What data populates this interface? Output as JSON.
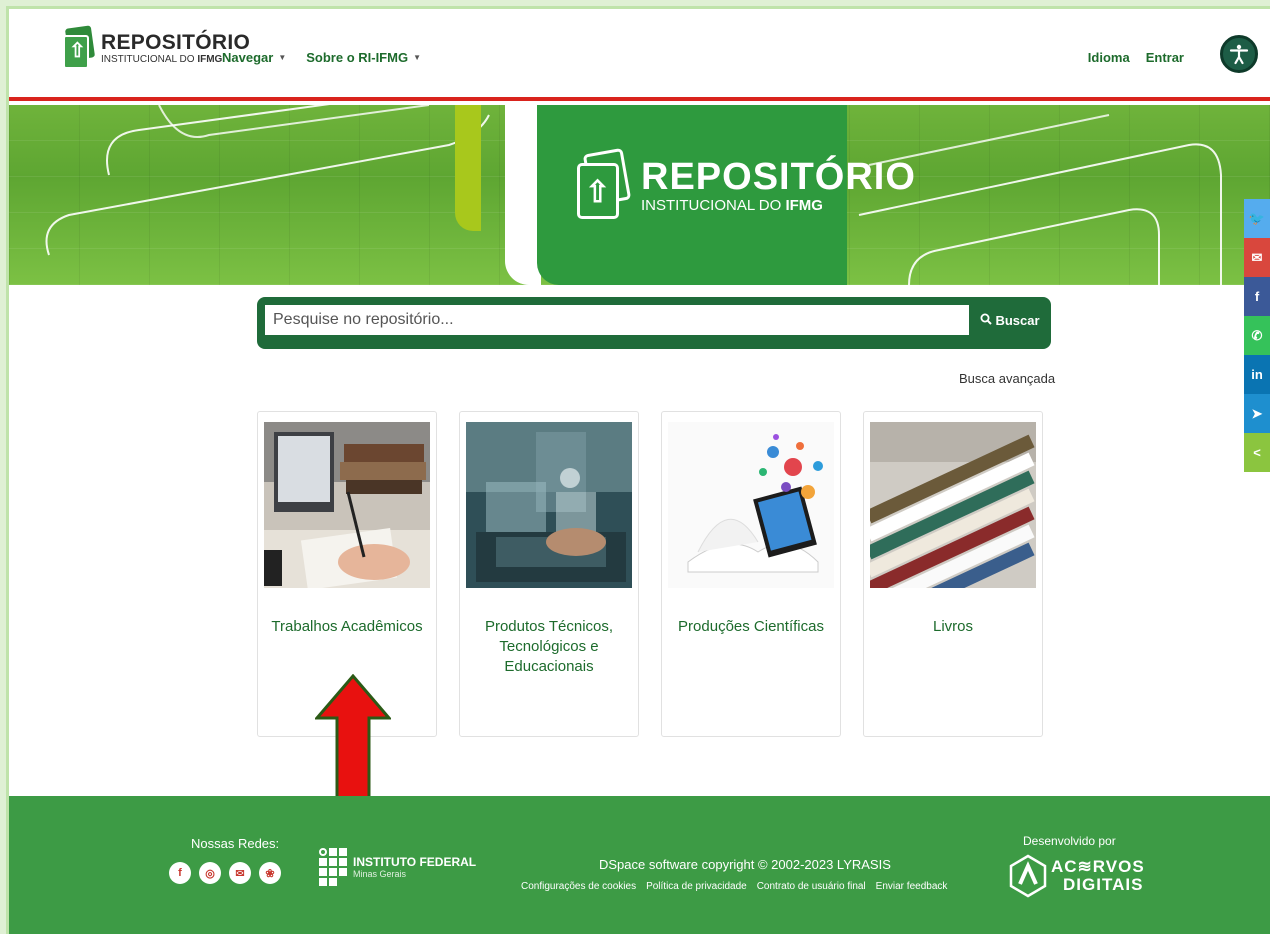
{
  "header": {
    "logo_title": "REPOSITÓRIO",
    "logo_subtitle_prefix": "INSTITUCIONAL DO ",
    "logo_subtitle_bold": "IFMG",
    "nav": [
      {
        "label": "Navegar"
      },
      {
        "label": "Sobre o RI-IFMG"
      }
    ],
    "language_label": "Idioma",
    "login_label": "Entrar",
    "accessibility_icon": "accessibility-icon"
  },
  "banner": {
    "title": "REPOSITÓRIO",
    "subtitle_prefix": "INSTITUCIONAL DO ",
    "subtitle_bold": "IFMG"
  },
  "share_bar": {
    "items": [
      {
        "icon": "twitter-icon",
        "glyph": "🐦",
        "color": "#55acee"
      },
      {
        "icon": "email-icon",
        "glyph": "✉",
        "color": "#d9473d"
      },
      {
        "icon": "facebook-icon",
        "glyph": "f",
        "color": "#3b5998"
      },
      {
        "icon": "whatsapp-icon",
        "glyph": "✆",
        "color": "#35c25a"
      },
      {
        "icon": "linkedin-icon",
        "glyph": "in",
        "color": "#0a74b2"
      },
      {
        "icon": "telegram-icon",
        "glyph": "➤",
        "color": "#1e8fcf"
      },
      {
        "icon": "share-icon",
        "glyph": "<",
        "color": "#8bc53f"
      }
    ]
  },
  "search": {
    "placeholder": "Pesquise no repositório...",
    "button_label": "Buscar",
    "advanced_label": "Busca avançada"
  },
  "cards": [
    {
      "label": "Trabalhos Acadêmicos"
    },
    {
      "label": "Produtos Técnicos, Tecnológicos e Educacionais"
    },
    {
      "label": "Produções Científicas"
    },
    {
      "label": "Livros"
    }
  ],
  "footer": {
    "social_title": "Nossas Redes:",
    "social": [
      {
        "icon": "facebook-icon",
        "glyph": "f"
      },
      {
        "icon": "instagram-icon",
        "glyph": "◎"
      },
      {
        "icon": "email-icon",
        "glyph": "✉"
      },
      {
        "icon": "flickr-icon",
        "glyph": "❀"
      }
    ],
    "institute_name": "INSTITUTO FEDERAL",
    "institute_region": "Minas Gerais",
    "copyright": "DSpace software copyright © 2002-2023 LYRASIS",
    "links": [
      {
        "label": "Configurações de cookies"
      },
      {
        "label": "Política de privacidade"
      },
      {
        "label": "Contrato de usuário final"
      },
      {
        "label": "Enviar feedback"
      }
    ],
    "developed_by": "Desenvolvido por",
    "developer_line1": "AC≋RVOS",
    "developer_line2": "DIGITAIS"
  }
}
